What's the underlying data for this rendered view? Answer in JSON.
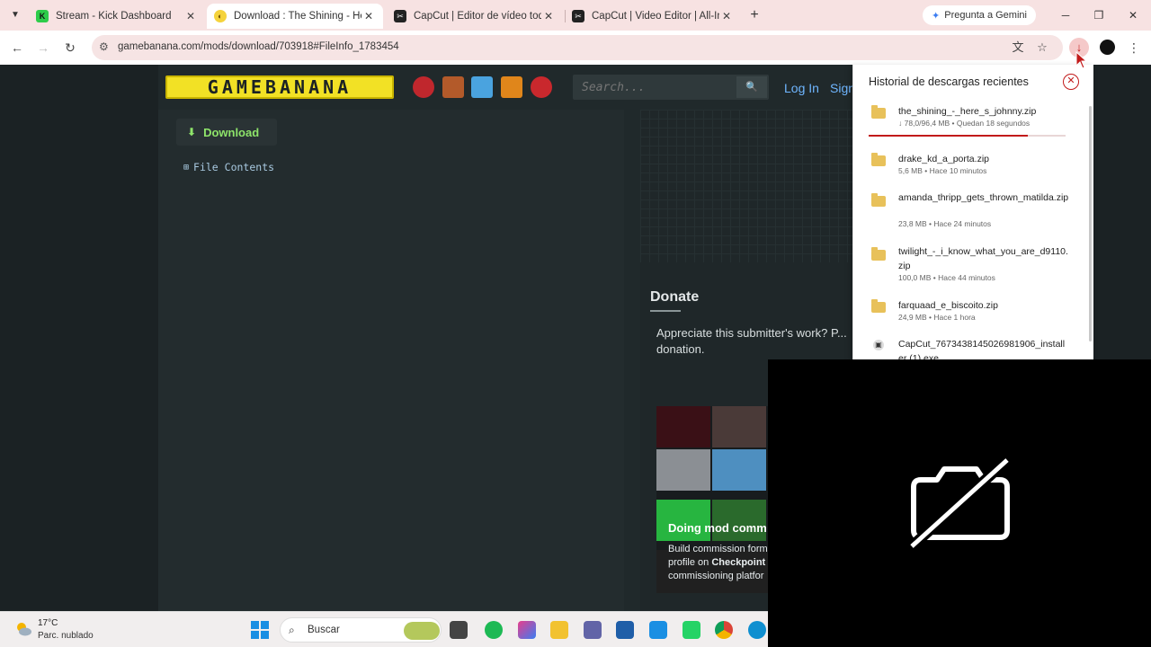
{
  "browser": {
    "tabs": [
      {
        "title": "Stream - Kick Dashboard",
        "favicon": "kick-icon",
        "active": false
      },
      {
        "title": "Download : The Shining - Here's",
        "favicon": "gamebanana-icon",
        "active": true
      },
      {
        "title": "CapCut | Editor de vídeo todo e",
        "favicon": "capcut-icon",
        "active": false
      },
      {
        "title": "CapCut | Video Editor | All-In-O",
        "favicon": "capcut-icon",
        "active": false
      }
    ],
    "gemini_label": "Pregunta a Gemini",
    "url": "gamebanana.com/mods/download/703918#FileInfo_1783454"
  },
  "site": {
    "logo_text": "GAMEBANANA",
    "search_placeholder": "Search...",
    "login_label": "Log In",
    "signup_label": "Sign Up",
    "download_label": "Download",
    "file_contents_label": "File Contents",
    "donate_title": "Donate",
    "donate_text": "Appreciate this submitter's work? P... donation.",
    "ad": {
      "title": "Doing mod comm",
      "line1": "Build commission form",
      "line2_prefix": "profile on ",
      "line2_bold": "Checkpoint",
      "line3": "commissioning platfor"
    }
  },
  "downloads": {
    "header": "Historial de descargas recientes",
    "progress_fraction": 0.81,
    "items": [
      {
        "name": "the_shining_-_here_s_johnny.zip",
        "meta": "↓ 78,0/96,4 MB • Quedan 18 segundos",
        "type": "folder"
      },
      {
        "name": "drake_kd_a_porta.zip",
        "meta": "5,6 MB • Hace 10 minutos",
        "type": "folder"
      },
      {
        "name": "amanda_thripp_gets_thrown_matilda.zip",
        "meta": "23,8 MB • Hace 24 minutos",
        "type": "folder"
      },
      {
        "name": "twilight_-_i_know_what_you_are_d9110.zip",
        "meta": "100,0 MB • Hace 44 minutos",
        "type": "folder"
      },
      {
        "name": "farquaad_e_biscoito.zip",
        "meta": "24,9 MB • Hace 1 hora",
        "type": "folder"
      },
      {
        "name": "CapCut_7673438145026981906_installer (1).exe",
        "meta": "",
        "type": "exe"
      }
    ]
  },
  "taskbar": {
    "weather_temp": "17°C",
    "weather_desc": "Parc. nublado",
    "search_placeholder": "Buscar"
  },
  "colors": {
    "accent_red": "#c21a1a",
    "download_green": "#8ee46a",
    "link_blue": "#6fb6ff",
    "logo_yellow": "#f2e125"
  }
}
